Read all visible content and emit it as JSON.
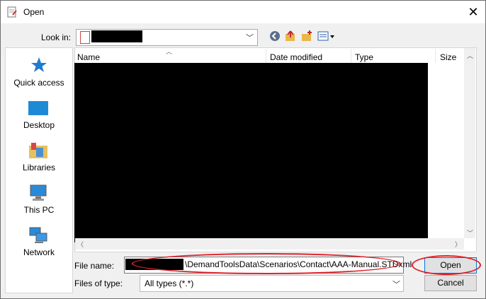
{
  "window": {
    "title": "Open",
    "close_glyph": "✕"
  },
  "look_in": {
    "label": "Look in:",
    "value_redacted": true
  },
  "toolbar": {
    "back_icon": "back-icon",
    "up_icon": "up-folder-icon",
    "new_folder_icon": "new-folder-icon",
    "view_icon": "view-menu-icon"
  },
  "places": [
    {
      "label": "Quick access",
      "icon": "star-icon"
    },
    {
      "label": "Desktop",
      "icon": "desktop-icon"
    },
    {
      "label": "Libraries",
      "icon": "libraries-icon"
    },
    {
      "label": "This PC",
      "icon": "computer-icon"
    },
    {
      "label": "Network",
      "icon": "network-icon"
    }
  ],
  "columns": [
    "Name",
    "Date modified",
    "Type",
    "Size"
  ],
  "file_name": {
    "label": "File name:",
    "value": "\\DemandToolsData\\Scenarios\\Contact\\AAA-Manual.STDxml"
  },
  "file_type": {
    "label": "Files of type:",
    "value": "All types (*.*)"
  },
  "buttons": {
    "open": "Open",
    "cancel": "Cancel"
  },
  "colors": {
    "annotation": "#e0202a",
    "accent": "#0078d7",
    "redaction": "#000000"
  }
}
